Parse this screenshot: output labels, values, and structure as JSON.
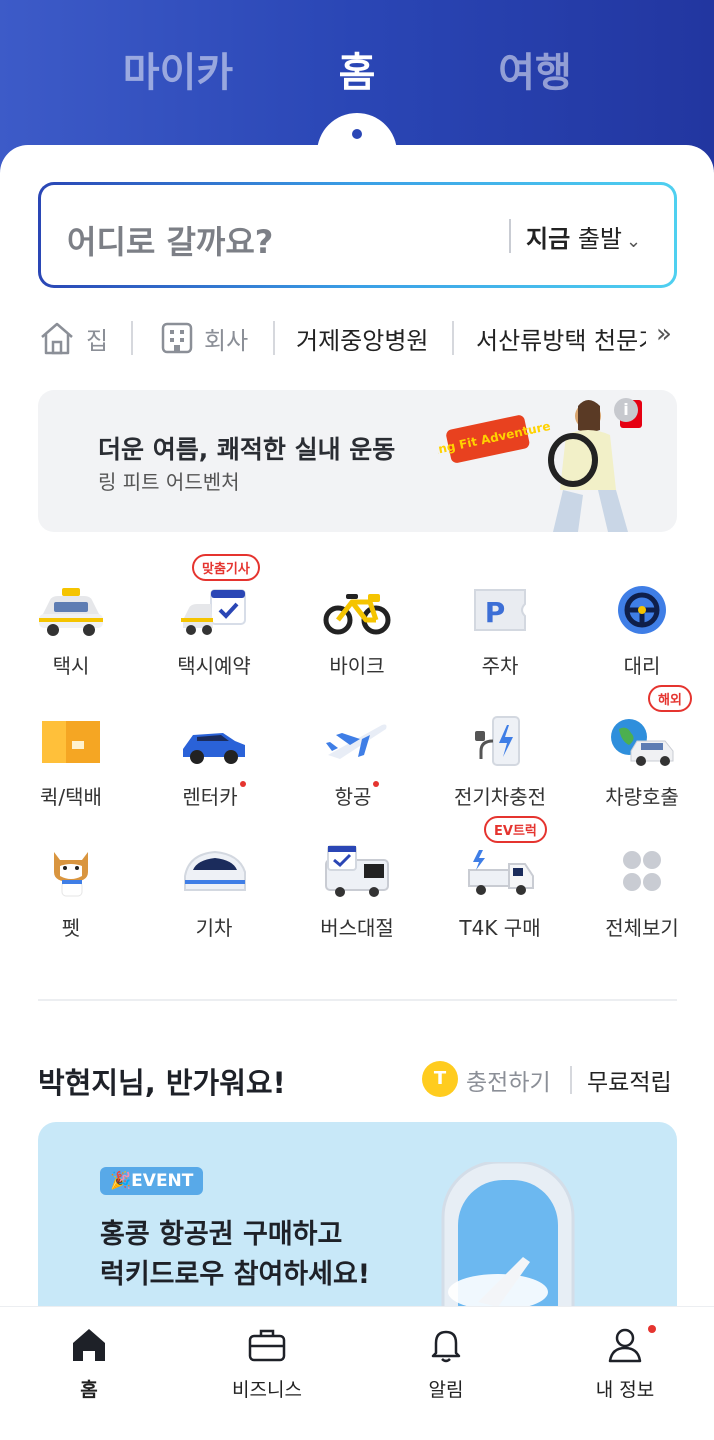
{
  "top_tabs": [
    {
      "label": "마이카"
    },
    {
      "label": "홈"
    },
    {
      "label": "여행"
    }
  ],
  "search": {
    "placeholder": "어디로 갈까요?",
    "depart_bold": "지금",
    "depart_text": "출발"
  },
  "favorites": {
    "home": "집",
    "work": "회사",
    "places": [
      "거제중앙병원",
      "서산류방택 천문기"
    ]
  },
  "banner": {
    "title": "더운 여름, 쾌적한 실내 운동",
    "subtitle": "링 피트 어드벤처",
    "image_text": "Ring Fit Adventure"
  },
  "services": [
    {
      "label": "택시",
      "icon": "taxi-icon"
    },
    {
      "label": "택시예약",
      "icon": "taxi-reserve-icon",
      "badge": "맞춤기사"
    },
    {
      "label": "바이크",
      "icon": "bike-icon"
    },
    {
      "label": "주차",
      "icon": "parking-icon"
    },
    {
      "label": "대리",
      "icon": "designated-driver-icon"
    },
    {
      "label": "퀵/택배",
      "icon": "parcel-icon"
    },
    {
      "label": "렌터카",
      "icon": "rental-car-icon",
      "dot": true
    },
    {
      "label": "항공",
      "icon": "airplane-icon",
      "dot": true
    },
    {
      "label": "전기차충전",
      "icon": "ev-charger-icon"
    },
    {
      "label": "차량호출",
      "icon": "car-call-icon",
      "badge": "해외"
    },
    {
      "label": "펫",
      "icon": "pet-icon"
    },
    {
      "label": "기차",
      "icon": "train-icon"
    },
    {
      "label": "버스대절",
      "icon": "bus-charter-icon"
    },
    {
      "label": "T4K 구매",
      "icon": "truck-icon",
      "badge": "EV트럭"
    },
    {
      "label": "전체보기",
      "icon": "grid-icon"
    }
  ],
  "greeting": {
    "text": "박현지님, 반가워요!",
    "coin": "T",
    "charge": "충전하기",
    "free": "무료적립"
  },
  "event": {
    "badge": "EVENT",
    "line1": "홍콩 항공권 구매하고",
    "line2": "럭키드로우 참여하세요!"
  },
  "bottom_nav": [
    {
      "label": "홈",
      "icon": "home-icon"
    },
    {
      "label": "비즈니스",
      "icon": "briefcase-icon"
    },
    {
      "label": "알림",
      "icon": "bell-icon"
    },
    {
      "label": "내 정보",
      "icon": "person-icon"
    }
  ],
  "colors": {
    "brand_blue": "#2a46b5",
    "badge_red": "#e5342f",
    "coin_yellow": "#ffcc1f"
  }
}
